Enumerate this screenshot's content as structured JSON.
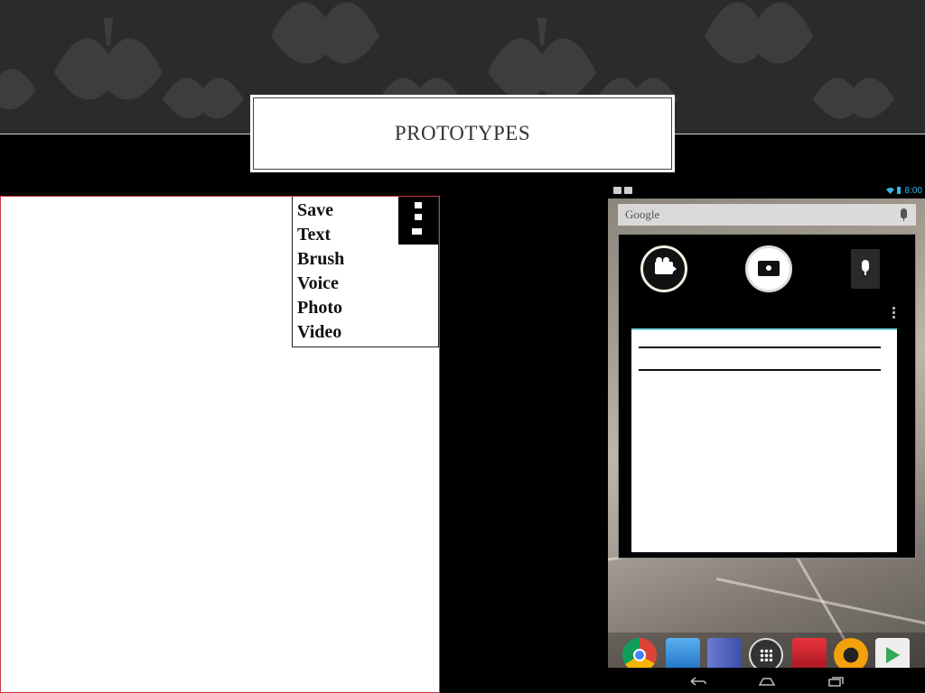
{
  "slide": {
    "title": "PROTOTYPES"
  },
  "sketch": {
    "menu": {
      "items": [
        "Save",
        "Text",
        "Brush",
        "Voice",
        "Photo",
        "Video"
      ]
    }
  },
  "tablet": {
    "status": {
      "time": "8:00"
    },
    "search": {
      "label": "Google"
    },
    "colors": {
      "accent": "#35b5e5",
      "note_border": "#7fd8e6"
    },
    "widget": {
      "buttons": [
        "video-icon",
        "camera-icon",
        "microphone-icon"
      ]
    },
    "dock": {
      "apps": [
        "chrome-icon",
        "books-icon",
        "magazines-icon",
        "all-apps-icon",
        "movies-icon",
        "music-icon",
        "play-store-icon"
      ]
    },
    "nav": [
      "back-icon",
      "home-icon",
      "recents-icon"
    ]
  }
}
